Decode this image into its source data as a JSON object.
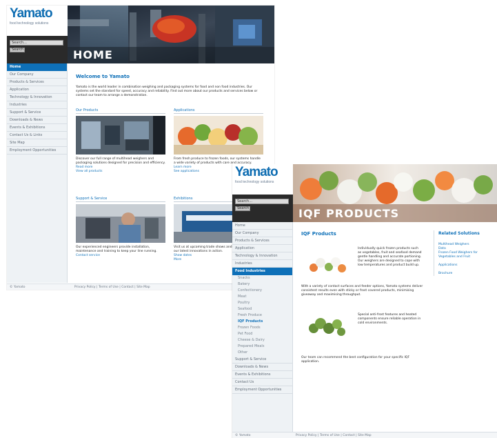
{
  "brand": {
    "name": "Yamato",
    "tagline": "food technology solutions"
  },
  "home": {
    "banner_title": "HOME",
    "search": {
      "placeholder": "Search...",
      "button": "Search"
    },
    "nav": [
      {
        "label": "Home",
        "active": true
      },
      {
        "label": "Our Company"
      },
      {
        "label": "Products & Services"
      },
      {
        "label": "Application"
      },
      {
        "label": "Technology & Innovation"
      },
      {
        "label": "Industries"
      },
      {
        "label": "Support & Service"
      },
      {
        "label": "Downloads & News"
      },
      {
        "label": "Events & Exhibitions"
      },
      {
        "label": "Contact Us & Links"
      },
      {
        "label": "Site Map"
      },
      {
        "label": "Employment Opportunities"
      }
    ],
    "welcome_title": "Welcome to Yamato",
    "welcome_text": "Yamato is the world leader in combination weighing and packaging systems for food and non food industries. Our systems set the standard for speed, accuracy and reliability. Find out more about our products and services below or contact our team to arrange a demonstration.",
    "cards": [
      {
        "heading": "Our Products",
        "text": "Discover our full range of multihead weighers and packaging solutions designed for precision and efficiency.",
        "link1": "Read more",
        "link2": "View all products"
      },
      {
        "heading": "Applications",
        "text": "From fresh produce to frozen foods, our systems handle a wide variety of products with care and accuracy.",
        "link1": "Learn more",
        "link2": "See applications"
      },
      {
        "heading": "Support & Service",
        "text": "Our experienced engineers provide installation, maintenance and training to keep your line running.",
        "link1": "Contact service"
      },
      {
        "heading": "Exhibitions",
        "text": "Visit us at upcoming trade shows and exhibitions to see our latest innovations in action.",
        "link1": "Show dates",
        "link2": "More"
      }
    ],
    "footer": "© Yamato",
    "footer_links": "Privacy Policy | Terms of Use | Contact | Site Map"
  },
  "iqf": {
    "banner_title": "IQF PRODUCTS",
    "search": {
      "placeholder": "Search...",
      "button": "Search"
    },
    "nav_top": [
      {
        "label": "Home"
      },
      {
        "label": "Our Company"
      },
      {
        "label": "Products & Services"
      },
      {
        "label": "Application"
      },
      {
        "label": "Technology & Innovation"
      },
      {
        "label": "Industries"
      },
      {
        "label": "Food Industries",
        "active": true
      }
    ],
    "nav_sub": [
      {
        "label": "Snacks"
      },
      {
        "label": "Bakery"
      },
      {
        "label": "Confectionery"
      },
      {
        "label": "Meat"
      },
      {
        "label": "Poultry"
      },
      {
        "label": "Seafood"
      },
      {
        "label": "Fresh Produce"
      },
      {
        "label": "IQF Products"
      },
      {
        "label": "Frozen Foods"
      },
      {
        "label": "Pet Food"
      },
      {
        "label": "Cheese & Dairy"
      },
      {
        "label": "Prepared Meals"
      },
      {
        "label": "Other"
      }
    ],
    "nav_bottom": [
      {
        "label": "Support & Service"
      },
      {
        "label": "Downloads & News"
      },
      {
        "label": "Events & Exhibitions"
      },
      {
        "label": "Contact Us"
      },
      {
        "label": "Employment Opportunities"
      }
    ],
    "section_title": "IQF Products",
    "para1": "Individually quick frozen products such as vegetables, fruit and seafood demand gentle handling and accurate portioning. Our weighers are designed to cope with low temperatures and product build up.",
    "para2": "With a variety of contact surfaces and feeder options, Yamato systems deliver consistent results even with sticky or frost covered products, minimising giveaway and maximising throughput.",
    "para3": "Special anti-frost features and heated components ensure reliable operation in cold environments.",
    "para4": "Our team can recommend the best configuration for your specific IQF application.",
    "right_title": "Related Solutions",
    "right_links": [
      "Multihead Weighers",
      "Data",
      "Frozen Food Weighers for Vegetables and Fruit",
      "Applications",
      "Brochure"
    ],
    "footer": "© Yamato",
    "footer_links": "Privacy Policy | Terms of Use | Contact | Site Map"
  }
}
